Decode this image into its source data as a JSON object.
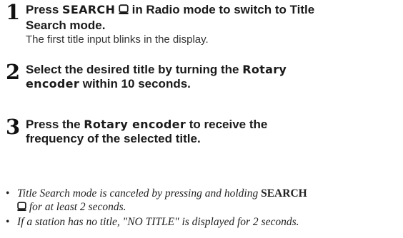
{
  "steps": [
    {
      "number": "1",
      "title_pre": "Press ",
      "title_kw": "SEARCH",
      "title_post": " in Radio mode to switch to Title",
      "title_line2": "Search mode.",
      "icon": "search-button-icon",
      "description": "The first title input blinks in the display."
    },
    {
      "number": "2",
      "title_pre": "Select the desired title by turning the ",
      "title_kw": "Rotary",
      "title_line2_kw": "encoder",
      "title_line2_post": " within 10 seconds."
    },
    {
      "number": "3",
      "title_pre": "Press the ",
      "title_kw": "Rotary encoder",
      "title_post": " to receive the",
      "title_line2": "frequency of the selected title."
    }
  ],
  "notes": [
    {
      "bullet": "•",
      "pre": "Title Search mode is canceled by pressing and holding ",
      "kw": "SEARCH",
      "line2_post": " for at least 2 seconds.",
      "icon": "search-button-icon"
    },
    {
      "bullet": "•",
      "text": "If a station has no title, \"NO TITLE\" is displayed for 2 seconds."
    }
  ]
}
